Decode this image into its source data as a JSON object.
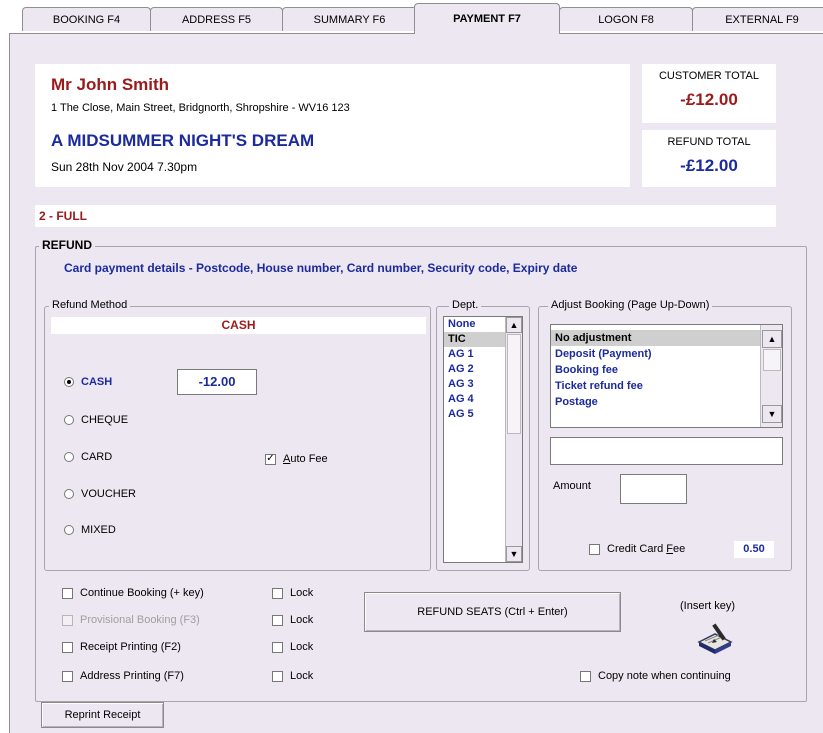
{
  "tabs": [
    {
      "label": "BOOKING F4"
    },
    {
      "label": "ADDRESS F5"
    },
    {
      "label": "SUMMARY F6"
    },
    {
      "label": "PAYMENT F7"
    },
    {
      "label": "LOGON  F8"
    },
    {
      "label": "EXTERNAL F9"
    }
  ],
  "customer": {
    "name": "Mr John Smith",
    "address": "1 The Close, Main Street, Bridgnorth, Shropshire - WV16 123"
  },
  "event": {
    "title": "A MIDSUMMER NIGHT'S DREAM",
    "datetime": "Sun 28th Nov 2004 7.30pm"
  },
  "totals": {
    "customer_label": "CUSTOMER TOTAL",
    "customer_value": "-£12.00",
    "refund_label": "REFUND TOTAL",
    "refund_value": "-£12.00"
  },
  "status": "2 - FULL",
  "refund": {
    "title": "REFUND",
    "card_details": "Card payment  details -  Postcode, House number, Card number, Security code, Expiry date"
  },
  "refund_method": {
    "legend": "Refund Method",
    "current": "CASH",
    "options": [
      "CASH",
      "CHEQUE",
      "CARD",
      "VOUCHER",
      "MIXED"
    ],
    "selected": "CASH",
    "cash_amount": "-12.00",
    "auto_fee_label_u": "A",
    "auto_fee_label_rest": "uto  Fee",
    "auto_fee_checked": true
  },
  "dept": {
    "legend": "Dept.",
    "items": [
      "None",
      "TIC",
      "AG 1",
      "AG 2",
      "AG 3",
      "AG 4",
      "AG 5"
    ],
    "selected": "TIC"
  },
  "adjust": {
    "legend": "Adjust Booking (Page Up-Down)",
    "items": [
      "No adjustment",
      "Deposit (Payment)",
      "Booking fee",
      "Ticket refund fee",
      "Postage"
    ],
    "selected": "No adjustment",
    "text_value": "",
    "amount_label": "Amount",
    "amount_value": "",
    "credit_fee_pre": "Credit Card ",
    "credit_fee_u": "F",
    "credit_fee_post": "ee",
    "credit_fee_checked": false,
    "fee_value": "0.50"
  },
  "options": {
    "continue_booking": "Continue Booking (+ key)",
    "provisional_booking": "Provisional Booking (F3)",
    "receipt_printing": "Receipt Printing (F2)",
    "address_printing": "Address Printing (F7)",
    "lock": "Lock",
    "copy_note": "Copy note when continuing"
  },
  "buttons": {
    "refund_seats": "REFUND SEATS (Ctrl + Enter)",
    "insert_key": "(Insert key)",
    "reprint_receipt": "Reprint Receipt"
  },
  "colors": {
    "panel_bg": "#ece7f1",
    "accent_red": "#9b1a1a",
    "accent_blue": "#1b2a9e"
  },
  "icons": {
    "note": "notepad-pen-icon"
  }
}
